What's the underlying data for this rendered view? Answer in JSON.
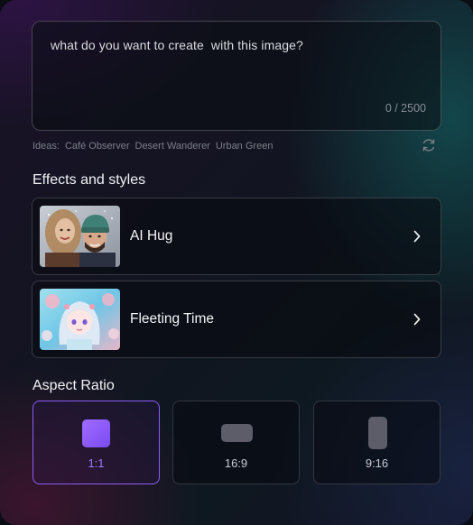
{
  "prompt": {
    "placeholder": "what do you want to create  with this image?",
    "char_count": "0 / 2500"
  },
  "ideas": {
    "label": "Ideas:",
    "items": [
      "Café Observer",
      "Desert Wanderer",
      "Urban Green"
    ],
    "refresh_icon": "refresh-icon"
  },
  "effects": {
    "title": "Effects and styles",
    "items": [
      {
        "label": "AI Hug",
        "thumb_icon": "couple-photo"
      },
      {
        "label": "Fleeting Time",
        "thumb_icon": "anime-girl-illustration"
      }
    ],
    "chevron_icon": "chevron-right-icon"
  },
  "aspect_ratio": {
    "title": "Aspect Ratio",
    "options": [
      "1:1",
      "16:9",
      "9:16"
    ],
    "selected": "1:1"
  },
  "colors": {
    "accent": "#8b5cf6",
    "accent_text": "#9b7cff"
  }
}
